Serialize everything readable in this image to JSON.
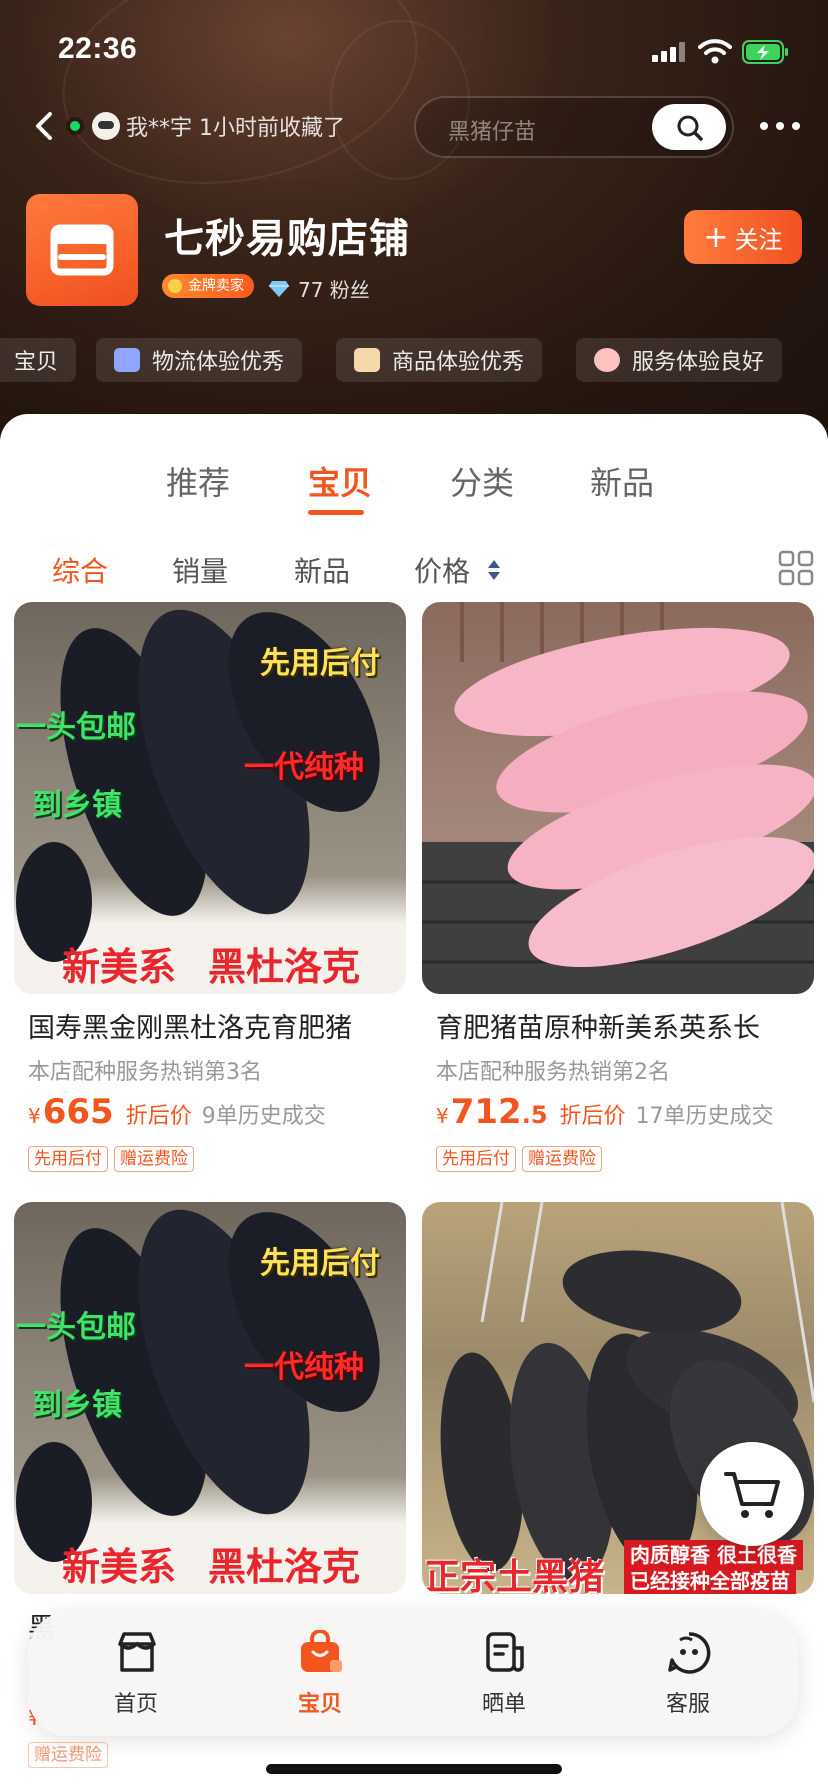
{
  "status_bar": {
    "time": "22:36"
  },
  "nav": {
    "recent_activity": "我**宇 1小时前收藏了",
    "search_placeholder": "黑猪仔苗"
  },
  "store": {
    "name": "七秒易购店铺",
    "badge": "金牌卖家",
    "fans": "77 粉丝",
    "follow_label": "关注"
  },
  "tags": [
    {
      "label": "宝贝",
      "icon": "tag-icon"
    },
    {
      "label": "物流体验优秀",
      "icon": "truck-icon"
    },
    {
      "label": "商品体验优秀",
      "icon": "bag-icon"
    },
    {
      "label": "服务体验良好",
      "icon": "service-icon"
    }
  ],
  "tabs": [
    "推荐",
    "宝贝",
    "分类",
    "新品"
  ],
  "active_tab": "宝贝",
  "sort_options": [
    "综合",
    "销量",
    "新品",
    "价格"
  ],
  "active_sort": "综合",
  "products": [
    {
      "title": "国寿黑金刚黑杜洛克育肥猪",
      "rank": "本店配种服务热销第3名",
      "price_symbol": "¥",
      "price_int": "665",
      "price_dec": "",
      "price_tag": "折后价",
      "history": "9单历史成交",
      "chips": [
        "先用后付",
        "赠运费险"
      ],
      "overlay": [
        "先用后付",
        "一头包邮",
        "一代纯种",
        "到乡镇",
        "新美系",
        "黑杜洛克"
      ]
    },
    {
      "title": "育肥猪苗原种新美系英系长",
      "rank": "本店配种服务热销第2名",
      "price_symbol": "¥",
      "price_int": "712",
      "price_dec": ".5",
      "price_tag": "折后价",
      "history": "17单历史成交",
      "chips": [
        "先用后付",
        "赠运费险"
      ],
      "overlay": []
    },
    {
      "title": "黑",
      "overlay": [
        "先用后付",
        "一头包邮",
        "一代纯种",
        "到乡镇",
        "新美系",
        "黑杜洛克"
      ]
    },
    {
      "title": "",
      "overlay": [
        "正宗土黑猪",
        "肉质醇香 很土很香",
        "已经接种全部疫苗"
      ]
    }
  ],
  "peek": {
    "price_symbol": "¥",
    "chip": "赠运费险"
  },
  "bottom_nav": [
    {
      "label": "首页",
      "icon": "shop-home-icon"
    },
    {
      "label": "宝贝",
      "icon": "bag-icon"
    },
    {
      "label": "晒单",
      "icon": "post-icon"
    },
    {
      "label": "客服",
      "icon": "service-face-icon"
    }
  ],
  "active_bottom": "宝贝",
  "colors": {
    "accent": "#f2561e",
    "hero": "#2a1811"
  }
}
